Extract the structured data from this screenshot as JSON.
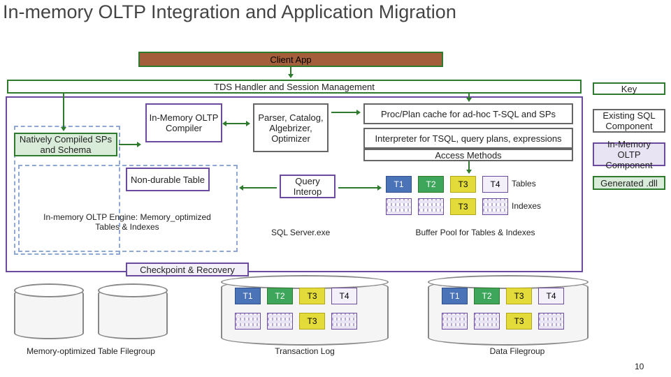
{
  "title": "In-memory OLTP Integration and Application Migration",
  "client": "Client App",
  "tds": "TDS Handler and Session Management",
  "natively": "Natively Compiled SPs and Schema",
  "compiler": "In-Memory OLTP Compiler",
  "parser": "Parser, Catalog, Algebrizer, Optimizer",
  "proc": "Proc/Plan cache for ad-hoc T-SQL and SPs",
  "interp1": "Interpreter for TSQL, query plans, expressions",
  "interp2": "Access Methods",
  "nondurable": "Non-durable Table",
  "qi": "Query Interop",
  "engine": "In-memory OLTP Engine: Memory_optimized Tables & Indexes",
  "checkpoint": "Checkpoint & Recovery",
  "sqlexe": "SQL Server.exe",
  "buffer": "Buffer Pool for Tables & Indexes",
  "tableslbl": "Tables",
  "indexeslbl": "Indexes",
  "txlog": "Transaction Log",
  "datafg": "Data Filegroup",
  "memfg": "Memory-optimized Table Filegroup",
  "key": "Key",
  "k1": "Existing SQL Component",
  "k2": "In-Memory OLTP Component",
  "k3": "Generated .dll",
  "t": {
    "t1": "T1",
    "t2": "T2",
    "t3": "T3",
    "t4": "T4"
  },
  "page": "10"
}
